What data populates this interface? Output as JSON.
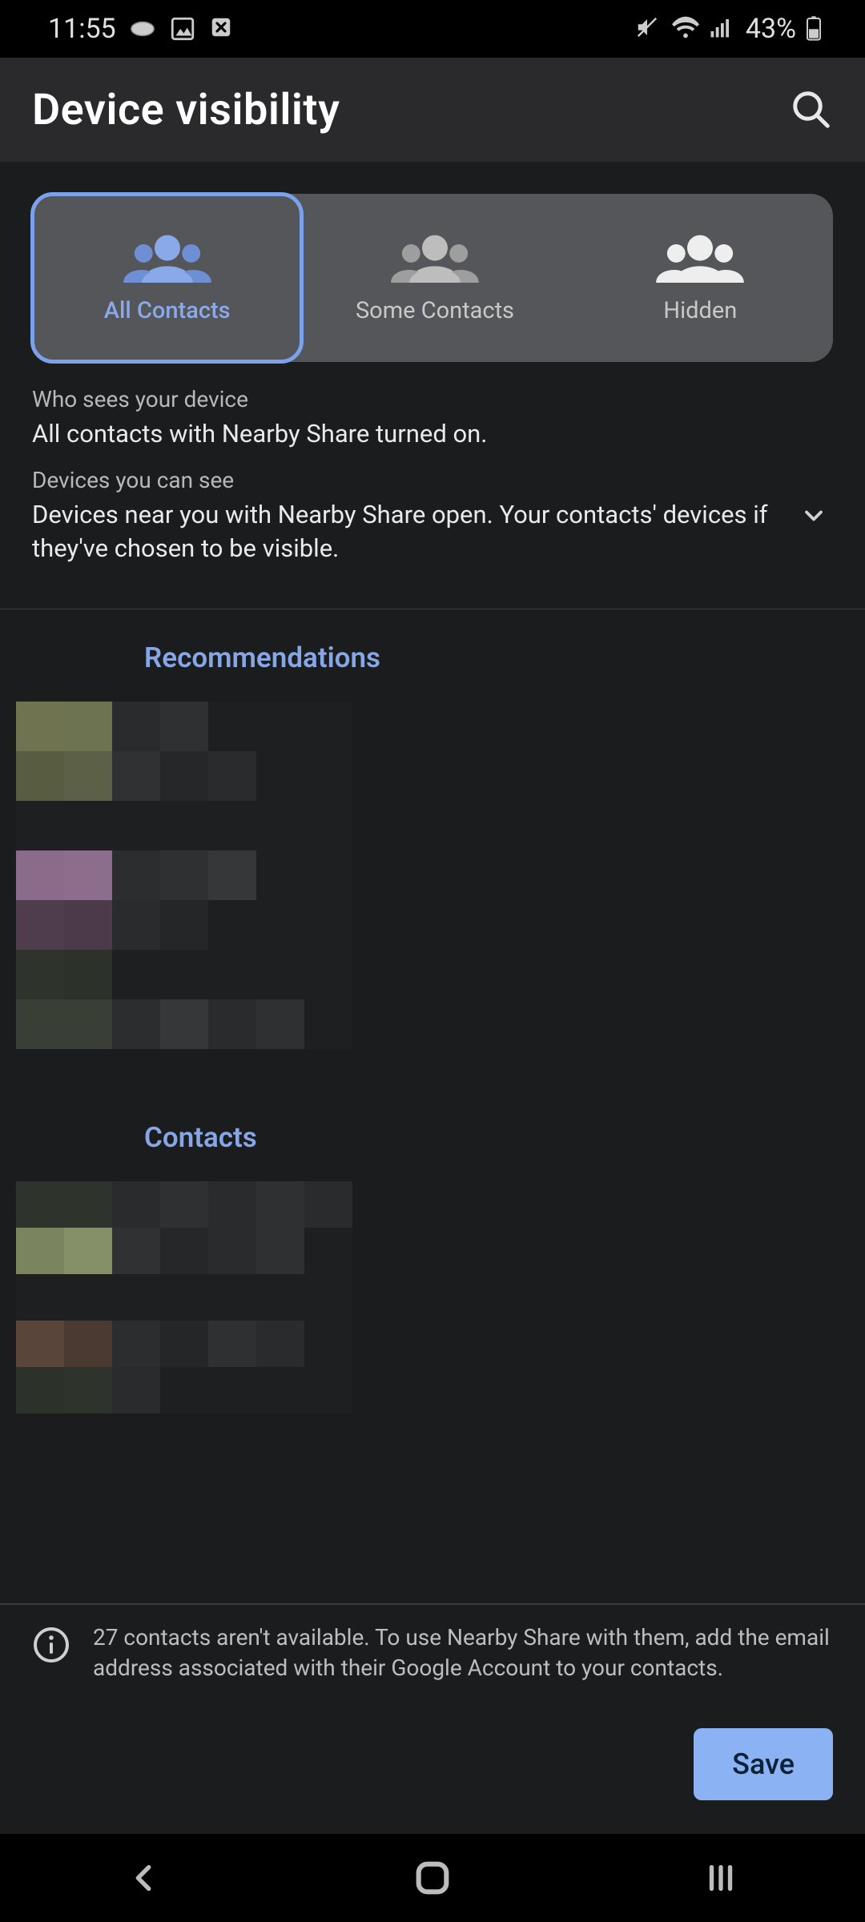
{
  "status": {
    "time": "11:55",
    "battery_text": "43%"
  },
  "header": {
    "title": "Device visibility"
  },
  "segmented": {
    "items": [
      {
        "label": "All Contacts",
        "selected": true
      },
      {
        "label": "Some Contacts",
        "selected": false
      },
      {
        "label": "Hidden",
        "selected": false
      }
    ]
  },
  "who_sees": {
    "title": "Who sees your device",
    "body": "All contacts with Nearby Share turned on."
  },
  "devices_you_can_see": {
    "title": "Devices you can see",
    "body": "Devices near you with Nearby Share open. Your contacts' devices if they've chosen to be visible."
  },
  "sections": {
    "recommendations_title": "Recommendations",
    "contacts_title": "Contacts"
  },
  "footer": {
    "info": "27 contacts aren't available. To use Nearby Share with them, add the email address associated with their Google Account to your contacts.",
    "save_label": "Save"
  },
  "colors": {
    "accent": "#8aa9e8",
    "save_bg": "#8bb2f3"
  }
}
